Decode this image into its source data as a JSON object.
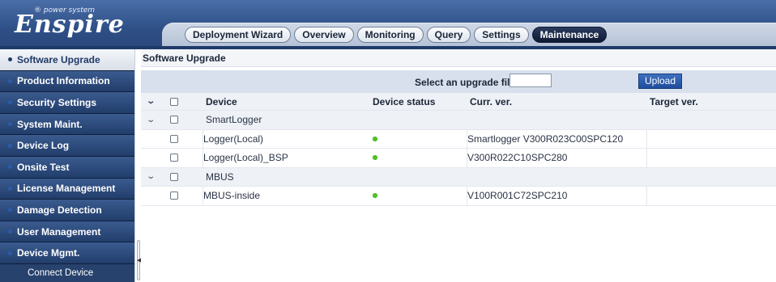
{
  "header": {
    "logo_tagline": "® power system",
    "logo_brand": "Enspire",
    "tabs": [
      {
        "label": "Deployment Wizard"
      },
      {
        "label": "Overview"
      },
      {
        "label": "Monitoring"
      },
      {
        "label": "Query"
      },
      {
        "label": "Settings"
      },
      {
        "label": "Maintenance",
        "active": true
      }
    ]
  },
  "sidebar": {
    "items": [
      {
        "label": "Software Upgrade",
        "active": true
      },
      {
        "label": "Product Information"
      },
      {
        "label": "Security Settings"
      },
      {
        "label": "System Maint."
      },
      {
        "label": "Device Log"
      },
      {
        "label": "Onsite Test"
      },
      {
        "label": "License Management"
      },
      {
        "label": "Damage Detection"
      },
      {
        "label": "User Management"
      },
      {
        "label": "Device Mgmt."
      }
    ],
    "sub_items": [
      {
        "label": "Connect Device"
      }
    ]
  },
  "main": {
    "section_title": "Software Upgrade",
    "upload": {
      "label": "Select an upgrade file:",
      "button": "Upload"
    },
    "columns": {
      "device": "Device",
      "status": "Device status",
      "current": "Curr. ver.",
      "target": "Target ver."
    },
    "groups": [
      {
        "name": "SmartLogger",
        "rows": [
          {
            "device": "Logger(Local)",
            "status": "online",
            "current": "Smartlogger V300R023C00SPC120",
            "target": ""
          },
          {
            "device": "Logger(Local)_BSP",
            "status": "online",
            "current": "V300R022C10SPC280",
            "target": ""
          }
        ]
      },
      {
        "name": "MBUS",
        "rows": [
          {
            "device": "MBUS-inside",
            "status": "online",
            "current": "V100R001C72SPC210",
            "target": ""
          }
        ]
      }
    ]
  },
  "colors": {
    "status_online": "#4ec423",
    "accent": "#1f4d9d",
    "sidebar_bg": "#213d6b"
  }
}
